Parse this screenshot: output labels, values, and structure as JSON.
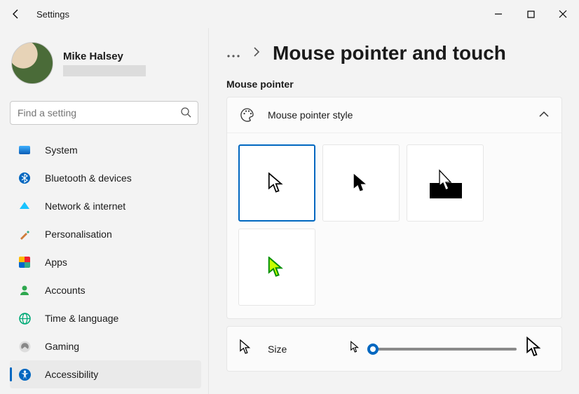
{
  "window": {
    "title": "Settings"
  },
  "user": {
    "name": "Mike Halsey"
  },
  "search": {
    "placeholder": "Find a setting"
  },
  "nav": {
    "items": [
      {
        "label": "System",
        "icon": "system"
      },
      {
        "label": "Bluetooth & devices",
        "icon": "bluetooth"
      },
      {
        "label": "Network & internet",
        "icon": "network"
      },
      {
        "label": "Personalisation",
        "icon": "paint"
      },
      {
        "label": "Apps",
        "icon": "apps"
      },
      {
        "label": "Accounts",
        "icon": "person"
      },
      {
        "label": "Time & language",
        "icon": "time"
      },
      {
        "label": "Gaming",
        "icon": "gaming"
      },
      {
        "label": "Accessibility",
        "icon": "access",
        "active": true
      }
    ]
  },
  "page": {
    "breadcrumb_more": "…",
    "heading": "Mouse pointer and touch",
    "section": "Mouse pointer",
    "style_card": {
      "label": "Mouse pointer style",
      "expanded": true,
      "options": [
        {
          "id": "white",
          "selected": true
        },
        {
          "id": "black"
        },
        {
          "id": "inverted"
        },
        {
          "id": "custom-color"
        }
      ]
    },
    "size_card": {
      "label": "Size",
      "value": 1,
      "min": 1,
      "max": 15
    }
  }
}
